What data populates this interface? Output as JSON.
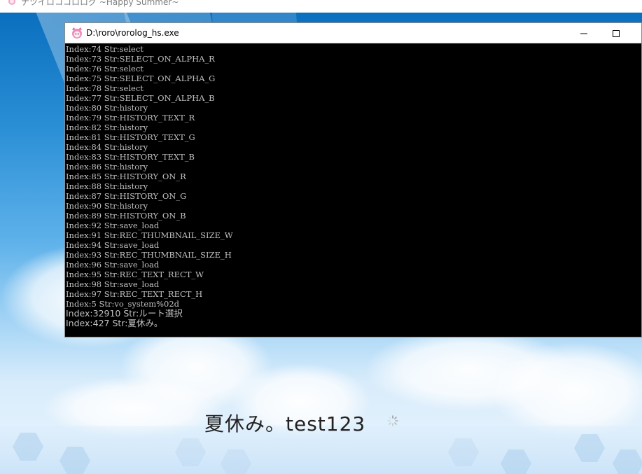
{
  "game_window": {
    "title": "ナツイロココロログ ~Happy Summer~"
  },
  "console_window": {
    "title": "D:\\roro\\rorolog_hs.exe",
    "lines": [
      "Index:74 Str:select",
      "Index:73 Str:SELECT_ON_ALPHA_R",
      "Index:76 Str:select",
      "Index:75 Str:SELECT_ON_ALPHA_G",
      "Index:78 Str:select",
      "Index:77 Str:SELECT_ON_ALPHA_B",
      "Index:80 Str:history",
      "Index:79 Str:HISTORY_TEXT_R",
      "Index:82 Str:history",
      "Index:81 Str:HISTORY_TEXT_G",
      "Index:84 Str:history",
      "Index:83 Str:HISTORY_TEXT_B",
      "Index:86 Str:history",
      "Index:85 Str:HISTORY_ON_R",
      "Index:88 Str:history",
      "Index:87 Str:HISTORY_ON_G",
      "Index:90 Str:history",
      "Index:89 Str:HISTORY_ON_B",
      "Index:92 Str:save_load",
      "Index:91 Str:REC_THUMBNAIL_SIZE_W",
      "Index:94 Str:save_load",
      "Index:93 Str:REC_THUMBNAIL_SIZE_H",
      "Index:96 Str:save_load",
      "Index:95 Str:REC_TEXT_RECT_W",
      "Index:98 Str:save_load",
      "Index:97 Str:REC_TEXT_RECT_H",
      "Index:5 Str:vo_system%02d",
      "Index:32910 Str:ルート選択",
      "Index:427 Str:夏休み。"
    ]
  },
  "game_scene": {
    "subtitle": "夏休み。test123"
  },
  "icons": {
    "app_icon": "cat-girl-app-icon",
    "minimize": "minimize-icon",
    "maximize": "maximize-icon",
    "loading": "loading-spinner-icon"
  },
  "colors": {
    "console_bg": "#000000",
    "console_text": "#c0c0c0",
    "sky_top": "#0a6fbe",
    "subtitle_text": "#222222"
  }
}
